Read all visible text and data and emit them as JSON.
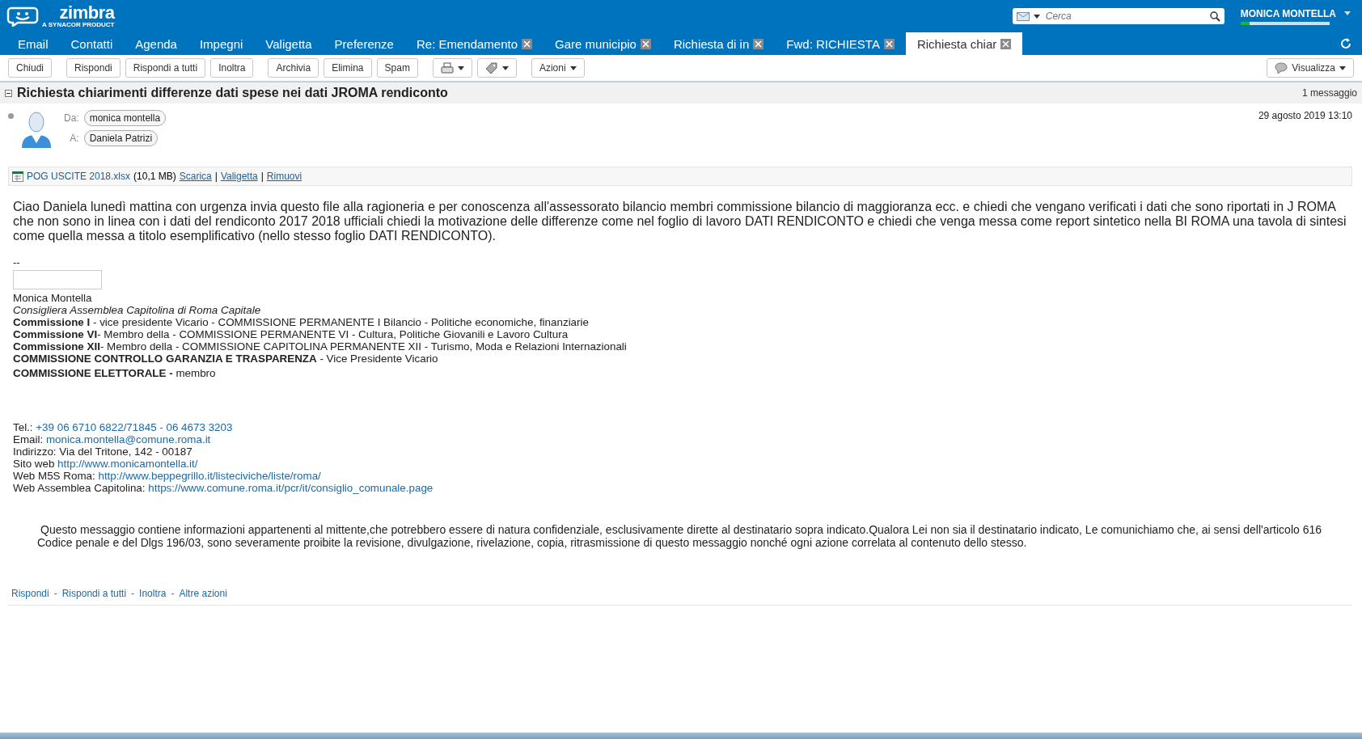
{
  "header": {
    "logo": {
      "name": "zimbra",
      "tagline": "A SYNACOR PRODUCT"
    },
    "search": {
      "placeholder": "Cerca"
    },
    "user": {
      "name": "MONICA MONTELLA",
      "quota": {
        "level": 0.1
      }
    }
  },
  "tabs": [
    {
      "label": "Email",
      "closable": false,
      "selected": false
    },
    {
      "label": "Contatti",
      "closable": false,
      "selected": false
    },
    {
      "label": "Agenda",
      "closable": false,
      "selected": false
    },
    {
      "label": "Impegni",
      "closable": false,
      "selected": false
    },
    {
      "label": "Valigetta",
      "closable": false,
      "selected": false
    },
    {
      "label": "Preferenze",
      "closable": false,
      "selected": false
    },
    {
      "label": "Re: Emendamento",
      "closable": true,
      "selected": false
    },
    {
      "label": "Gare municipio",
      "closable": true,
      "selected": false
    },
    {
      "label": "Richiesta di in",
      "closable": true,
      "selected": false
    },
    {
      "label": "Fwd: RICHIESTA",
      "closable": true,
      "selected": false
    },
    {
      "label": "Richiesta chiar",
      "closable": true,
      "selected": true
    }
  ],
  "toolbar": [
    {
      "kind": "text",
      "label": "Chiudi"
    },
    {
      "kind": "gap"
    },
    {
      "kind": "text",
      "label": "Rispondi"
    },
    {
      "kind": "text",
      "label": "Rispondi a tutti"
    },
    {
      "kind": "text",
      "label": "Inoltra"
    },
    {
      "kind": "gap"
    },
    {
      "kind": "text",
      "label": "Archivia"
    },
    {
      "kind": "text",
      "label": "Elimina"
    },
    {
      "kind": "text",
      "label": "Spam"
    },
    {
      "kind": "gap"
    },
    {
      "kind": "print"
    },
    {
      "kind": "tag"
    },
    {
      "kind": "gap"
    },
    {
      "kind": "menu",
      "label": "Azioni"
    }
  ],
  "view_button": "Visualizza",
  "conversation": {
    "subject": "Richiesta chiarimenti differenze dati spese nei dati JROMA rendiconto",
    "count": "1 messaggio"
  },
  "message": {
    "from_label": "Da:",
    "from": "monica montella",
    "to_label": "A:",
    "to": "Daniela Patrizi",
    "date": "29 agosto 2019 13:10",
    "attachment": {
      "name": "POG USCITE 2018.xlsx",
      "size": "(10,1 MB)",
      "actions": [
        "Scarica",
        "Valigetta",
        "Rimuovi"
      ],
      "action_separator": "|"
    },
    "body": "Ciao Daniela lunedì mattina con urgenza invia questo file alla ragioneria e per conoscenza all'assessorato bilancio membri commissione bilancio di maggioranza ecc. e chiedi che vengano verificati i dati che sono riportati in J ROMA che non sono in linea con i dati del rendiconto 2017 2018 ufficiali chiedi la motivazione delle differenze come nel foglio di lavoro DATI RENDICONTO e chiedi che venga messa come report sintetico nella BI ROMA una tavola di sintesi come quella messa a titolo esemplificativo (nello stesso foglio DATI RENDICONTO).",
    "separator": "--",
    "signature": {
      "name": "Monica Montella",
      "role": "Consigliera Assemblea Capitolina di Roma Capitale",
      "roles": [
        "**Commissione I** - vice presidente Vicario - COMMISSIONE PERMANENTE I Bilancio - Politiche economiche, finanziarie",
        "**Commissione VI**- Membro della - COMMISSIONE PERMANENTE VI - Cultura, Politiche Giovanili e Lavoro Cultura",
        "**Commissione XII**- Membro della - COMMISSIONE CAPITOLINA PERMANENTE XII - Turismo, Moda e Relazioni Internazionali",
        "**COMMISSIONE CONTROLLO GARANZIA E TRASPARENZA** - Vice Presidente Vicario",
        "**COMMISSIONE ELETTORALE -** membro"
      ],
      "contacts": [
        {
          "label": "Tel.:",
          "link": "+39 06 6710 6822/71845 - 06 4673 3203"
        },
        {
          "label": "Email:",
          "link": "monica.montella@comune.roma.it"
        },
        {
          "label": "Indirizzo: Via del Tritone, 142 - 00187"
        },
        {
          "label": "Sito web",
          "link": "http://www.monicamontella.it/"
        },
        {
          "label": "Web M5S Roma:",
          "link": "http://www.beppegrillo.it/listeciviche/liste/roma/"
        },
        {
          "label": "Web Assemblea Capitolina:",
          "link": "https://www.comune.roma.it/pcr/it/consiglio_comunale.page"
        }
      ]
    },
    "disclaimer": "Questo messaggio contiene informazioni appartenenti al mittente,che potrebbero essere di natura confidenziale, esclusivamente dirette al destinatario sopra indicato.Qualora Lei non sia il destinatario indicato, Le comunichiamo che, ai sensi dell'articolo 616 Codice penale e del Dlgs 196/03, sono severamente proibite la revisione, divulgazione, rivelazione, copia, ritrasmissione di questo messaggio nonché ogni azione correlata al contenuto dello stesso.",
    "footer_links": [
      "Rispondi",
      "Rispondi a tutti",
      "Inoltra",
      "Altre azioni"
    ],
    "footer_separator": "-"
  }
}
